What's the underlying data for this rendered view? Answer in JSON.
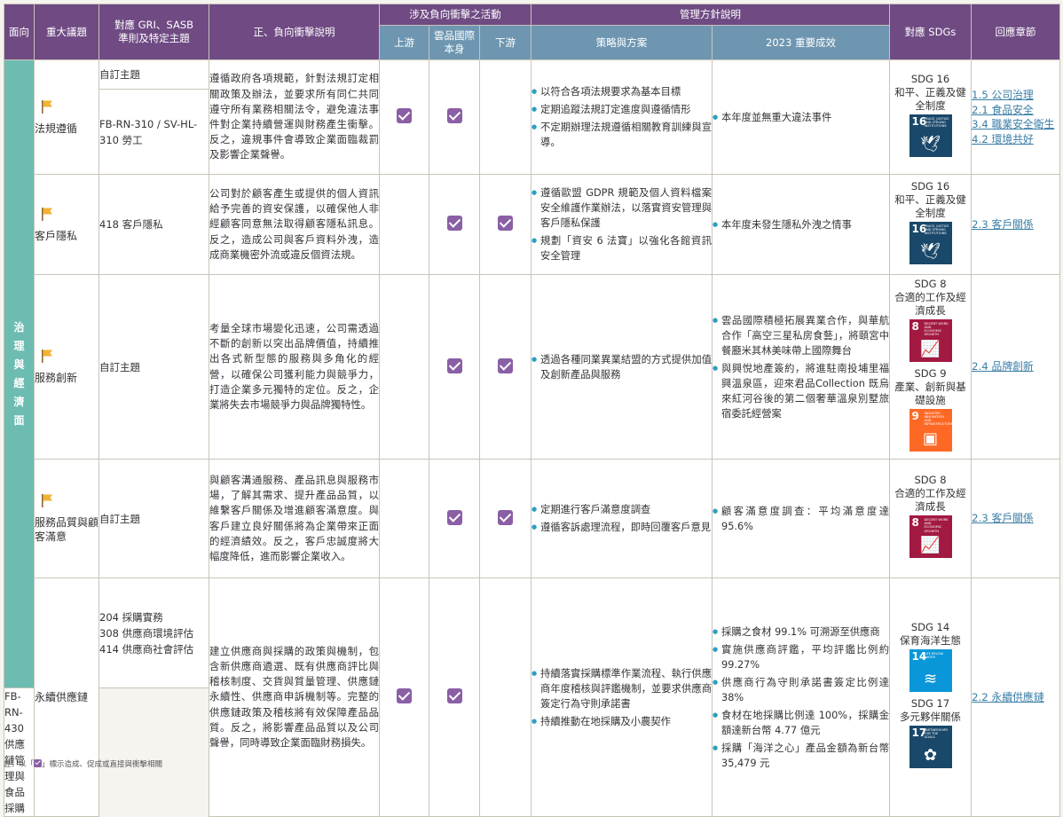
{
  "header": {
    "aspect": "面向",
    "topic": "重大議題",
    "standard": "對應 GRI、SASB\n準則及特定主題",
    "impact": "正、負向衝擊說明",
    "activities": "涉及負向衝擊之活動",
    "upstream": "上游",
    "self": "雲品國際\n本身",
    "downstream": "下游",
    "management": "管理方針說明",
    "strategy": "策略與方案",
    "results": "2023 重要成效",
    "sdgs": "對應 SDGs",
    "chapter": "回應章節"
  },
  "aspect_label": "治理與經濟面",
  "colors": {
    "header_purple": "#6f4a83",
    "header_blue": "#6e96b1",
    "aspect_teal": "#6dbcb1",
    "check_purple": "#8a5fa5",
    "flag_yellow": "#f2b233",
    "link_blue": "#3a7ea6"
  },
  "rows": [
    {
      "topic": "法規遵循",
      "flag_icon": "flag-icon",
      "standards": [
        "自訂主題",
        "FB-RN-310 / SV-HL-310 勞工"
      ],
      "impact": "遵循政府各項規範，針對法規訂定相關政策及辦法，並要求所有同仁共同遵守所有業務相關法令，避免違法事件對企業持續營運與財務產生衝擊。反之，違規事件會導致企業面臨裁罰及影響企業聲譽。",
      "upstream": true,
      "self": true,
      "downstream": false,
      "strategy": [
        "以符合各項法規要求為基本目標",
        "定期追蹤法規訂定進度與遵循情形",
        "不定期辦理法規遵循相關教育訓練與宣導。"
      ],
      "results": [
        "本年度並無重大違法事件"
      ],
      "sdgs": [
        {
          "title": "SDG 16",
          "subtitle": "和平、正義及健全制度",
          "num": "16",
          "caption": "PEACE, JUSTICE AND STRONG INSTITUTIONS",
          "color": "#19486a",
          "icon": "dove-gavel-icon"
        }
      ],
      "chapters": [
        "1.5 公司治理",
        "2.1 食品安全",
        "3.4 職業安全衛生",
        "4.2 環境共好"
      ]
    },
    {
      "topic": "客戶隱私",
      "flag_icon": "flag-icon",
      "standards": [
        "418 客戶隱私"
      ],
      "impact": "公司對於顧客產生或提供的個人資訊給予完善的資安保護，以確保他人非經顧客同意無法取得顧客隱私訊息。反之，造成公司與客戶資料外洩，造成商業機密外流或違反個資法規。",
      "upstream": false,
      "self": true,
      "downstream": true,
      "strategy": [
        "遵循歐盟 GDPR 規範及個人資料檔案安全維護作業辦法，以落實資安管理與客戶隱私保護",
        "規劃「資安 6 法寶」以強化各館資訊安全管理"
      ],
      "results": [
        "本年度未發生隱私外洩之情事"
      ],
      "sdgs": [
        {
          "title": "SDG 16",
          "subtitle": "和平、正義及健全制度",
          "num": "16",
          "caption": "PEACE, JUSTICE AND STRONG INSTITUTIONS",
          "color": "#19486a",
          "icon": "dove-gavel-icon"
        }
      ],
      "chapters": [
        "2.3 客戶關係"
      ]
    },
    {
      "topic": "服務創新",
      "flag_icon": "flag-icon",
      "standards": [
        "自訂主題"
      ],
      "impact": "考量全球市場變化迅速，公司需透過不斷的創新以突出品牌價值，持續推出各式新型態的服務與多角化的經營，以確保公司獲利能力與競爭力，打造企業多元獨特的定位。反之，企業將失去市場競爭力與品牌獨特性。",
      "upstream": false,
      "self": true,
      "downstream": true,
      "strategy": [
        "透過各種同業異業結盟的方式提供加值及創新產品與服務"
      ],
      "results": [
        "雲品國際積極拓展異業合作，與華航合作「高空三星私房食藝」，將頤宮中餐廳米其林美味帶上國際舞台",
        "與興悅地產簽約，將進駐南投埔里福興溫泉區，迎來君品Collection 既烏來紅河谷後的第二個奢華溫泉別墅旅宿委託經營案"
      ],
      "sdgs": [
        {
          "title": "SDG 8",
          "subtitle": "合適的工作及經濟成長",
          "num": "8",
          "caption": "DECENT WORK AND ECONOMIC GROWTH",
          "color": "#a21942",
          "icon": "growth-chart-icon"
        },
        {
          "title": "SDG 9",
          "subtitle": "產業、創新與基礎設施",
          "num": "9",
          "caption": "INDUSTRY, INNOVATION AND INFRASTRUCTURE",
          "color": "#fd6925",
          "icon": "cubes-icon"
        }
      ],
      "chapters": [
        "2.4 品牌創新"
      ]
    },
    {
      "topic": "服務品質與顧客滿意",
      "flag_icon": "flag-icon",
      "standards": [
        "自訂主題"
      ],
      "impact": "與顧客溝通服務、產品訊息與服務市場，了解其需求、提升產品品質，以維繫客戶關係及增進顧客滿意度。與客戶建立良好關係將為企業帶來正面的經濟績效。反之，客戶忠誠度將大幅度降低，進而影響企業收入。",
      "upstream": false,
      "self": true,
      "downstream": true,
      "strategy": [
        "定期進行客戶滿意度調查",
        "遵循客訴處理流程，即時回覆客戶意見"
      ],
      "results": [
        "顧客滿意度調查：平均滿意度達95.6%"
      ],
      "sdgs": [
        {
          "title": "SDG 8",
          "subtitle": "合適的工作及經濟成長",
          "num": "8",
          "caption": "DECENT WORK AND ECONOMIC GROWTH",
          "color": "#a21942",
          "icon": "growth-chart-icon"
        }
      ],
      "chapters": [
        "2.3 客戶關係"
      ]
    },
    {
      "topic": "永續供應鏈",
      "flag_icon": "",
      "standards": [
        "204 採購實務\n308 供應商環境評估\n414 供應商社會評估",
        "FB-RN-430 供應鏈管理與食品採購"
      ],
      "impact": "建立供應商與採購的政策與機制，包含新供應商遴選、既有供應商評比與稽核制度、交貨與質量管理、供應鏈永續性、供應商申訴機制等。完整的供應鏈政策及稽核將有效保障產品品質。反之，將影響產品品質以及公司聲譽，同時導致企業面臨財務損失。",
      "upstream": true,
      "self": true,
      "downstream": false,
      "strategy": [
        "持續落實採購標準作業流程、執行供應商年度稽核與評鑑機制，並要求供應商簽定行為守則承諾書",
        "持續推動在地採購及小農契作"
      ],
      "results": [
        "採購之食材 99.1% 可溯源至供應商",
        "實施供應商評鑑，平均評鑑比例約 99.27%",
        "供應商行為守則承諾書簽定比例達 38%",
        "食材在地採購比例達 100%，採購金額達新台幣 4.77 億元",
        "採購「海洋之心」產品金額為新台幣 35,479 元"
      ],
      "sdgs": [
        {
          "title": "SDG 14",
          "subtitle": "保育海洋生態",
          "num": "14",
          "caption": "LIFE BELOW WATER",
          "color": "#0a97d9",
          "icon": "fish-waves-icon"
        },
        {
          "title": "SDG 17",
          "subtitle": "多元夥伴關係",
          "num": "17",
          "caption": "PARTNERSHIPS FOR THE GOALS",
          "color": "#19486a",
          "icon": "rings-icon"
        }
      ],
      "chapters": [
        "2.2 永續供應鏈"
      ]
    }
  ],
  "footnote": {
    "prefix": "註：以「",
    "suffix": "」標示造成、促成或直接與衝擊相關",
    "icon": "check-icon"
  }
}
